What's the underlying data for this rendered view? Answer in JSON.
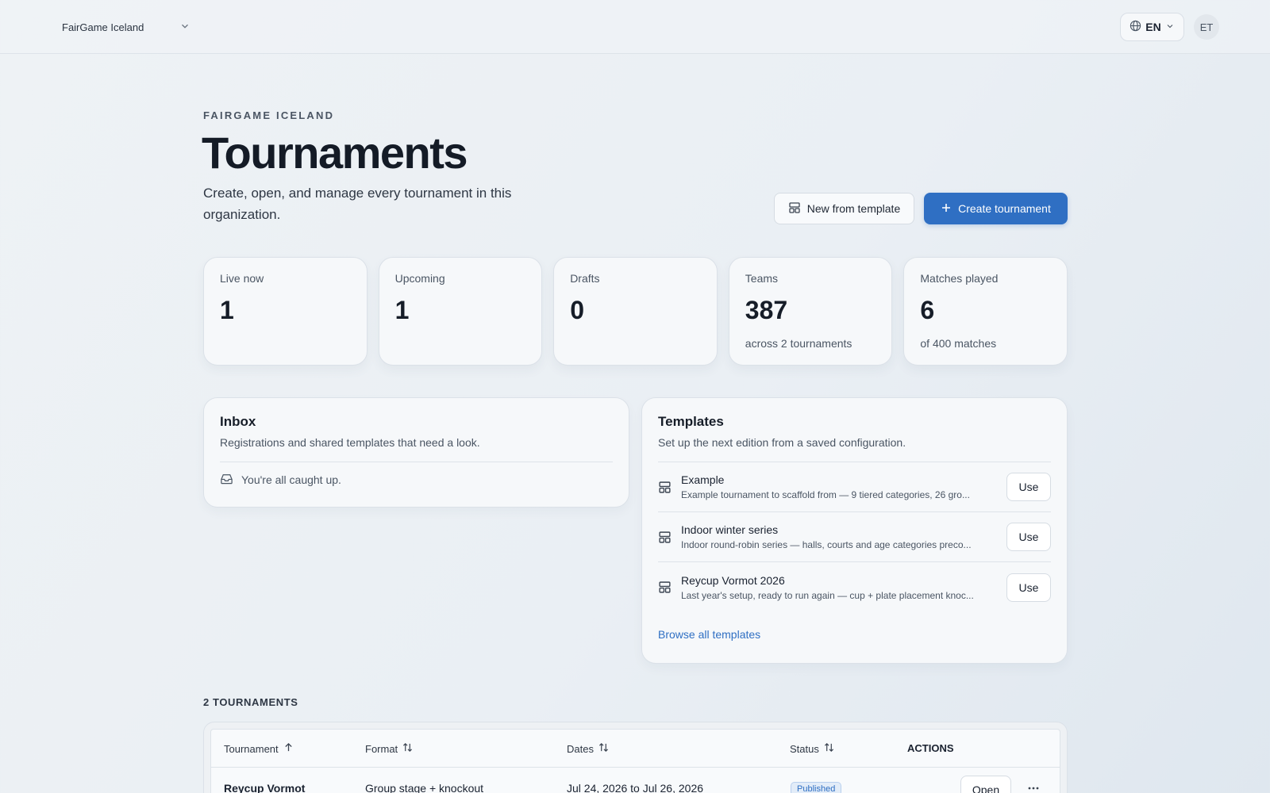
{
  "topbar": {
    "org_name": "FairGame Iceland",
    "language": "EN",
    "avatar_initials": "ET"
  },
  "header": {
    "eyebrow": "FAIRGAME ICELAND",
    "title": "Tournaments",
    "subtitle": "Create, open, and manage every tournament in this organization.",
    "new_from_template_label": "New from template",
    "create_label": "Create tournament"
  },
  "stats": [
    {
      "label": "Live now",
      "value": "1",
      "note": ""
    },
    {
      "label": "Upcoming",
      "value": "1",
      "note": ""
    },
    {
      "label": "Drafts",
      "value": "0",
      "note": ""
    },
    {
      "label": "Teams",
      "value": "387",
      "note": "across 2 tournaments"
    },
    {
      "label": "Matches played",
      "value": "6",
      "note": "of 400 matches"
    }
  ],
  "inbox": {
    "title": "Inbox",
    "description": "Registrations and shared templates that need a look.",
    "empty_message": "You're all caught up."
  },
  "templates": {
    "title": "Templates",
    "description": "Set up the next edition from a saved configuration.",
    "items": [
      {
        "name": "Example",
        "description": "Example tournament to scaffold from — 9 tiered categories, 26 gro...",
        "action": "Use"
      },
      {
        "name": "Indoor winter series",
        "description": "Indoor round-robin series — halls, courts and age categories preco...",
        "action": "Use"
      },
      {
        "name": "Reycup Vormot 2026",
        "description": "Last year's setup, ready to run again — cup + plate placement knoc...",
        "action": "Use"
      }
    ],
    "browse_label": "Browse all templates"
  },
  "tournaments": {
    "count_label": "2 TOURNAMENTS",
    "columns": {
      "tournament": "Tournament",
      "format": "Format",
      "dates": "Dates",
      "status": "Status",
      "actions": "ACTIONS"
    },
    "rows": [
      {
        "name": "Reycup Vormot",
        "format": "Group stage + knockout",
        "dates": "Jul 24, 2026 to Jul 26, 2026",
        "status": "Published",
        "open_label": "Open"
      }
    ]
  },
  "colors": {
    "accent": "#2f6fc3",
    "background": "#eef2f5",
    "text": "#1a2230"
  },
  "icons": [
    "chevron-down-icon",
    "globe-icon",
    "template-icon",
    "plus-icon",
    "inbox-tray-icon",
    "sort-up-icon",
    "sort-both-icon",
    "more-horizontal-icon"
  ]
}
